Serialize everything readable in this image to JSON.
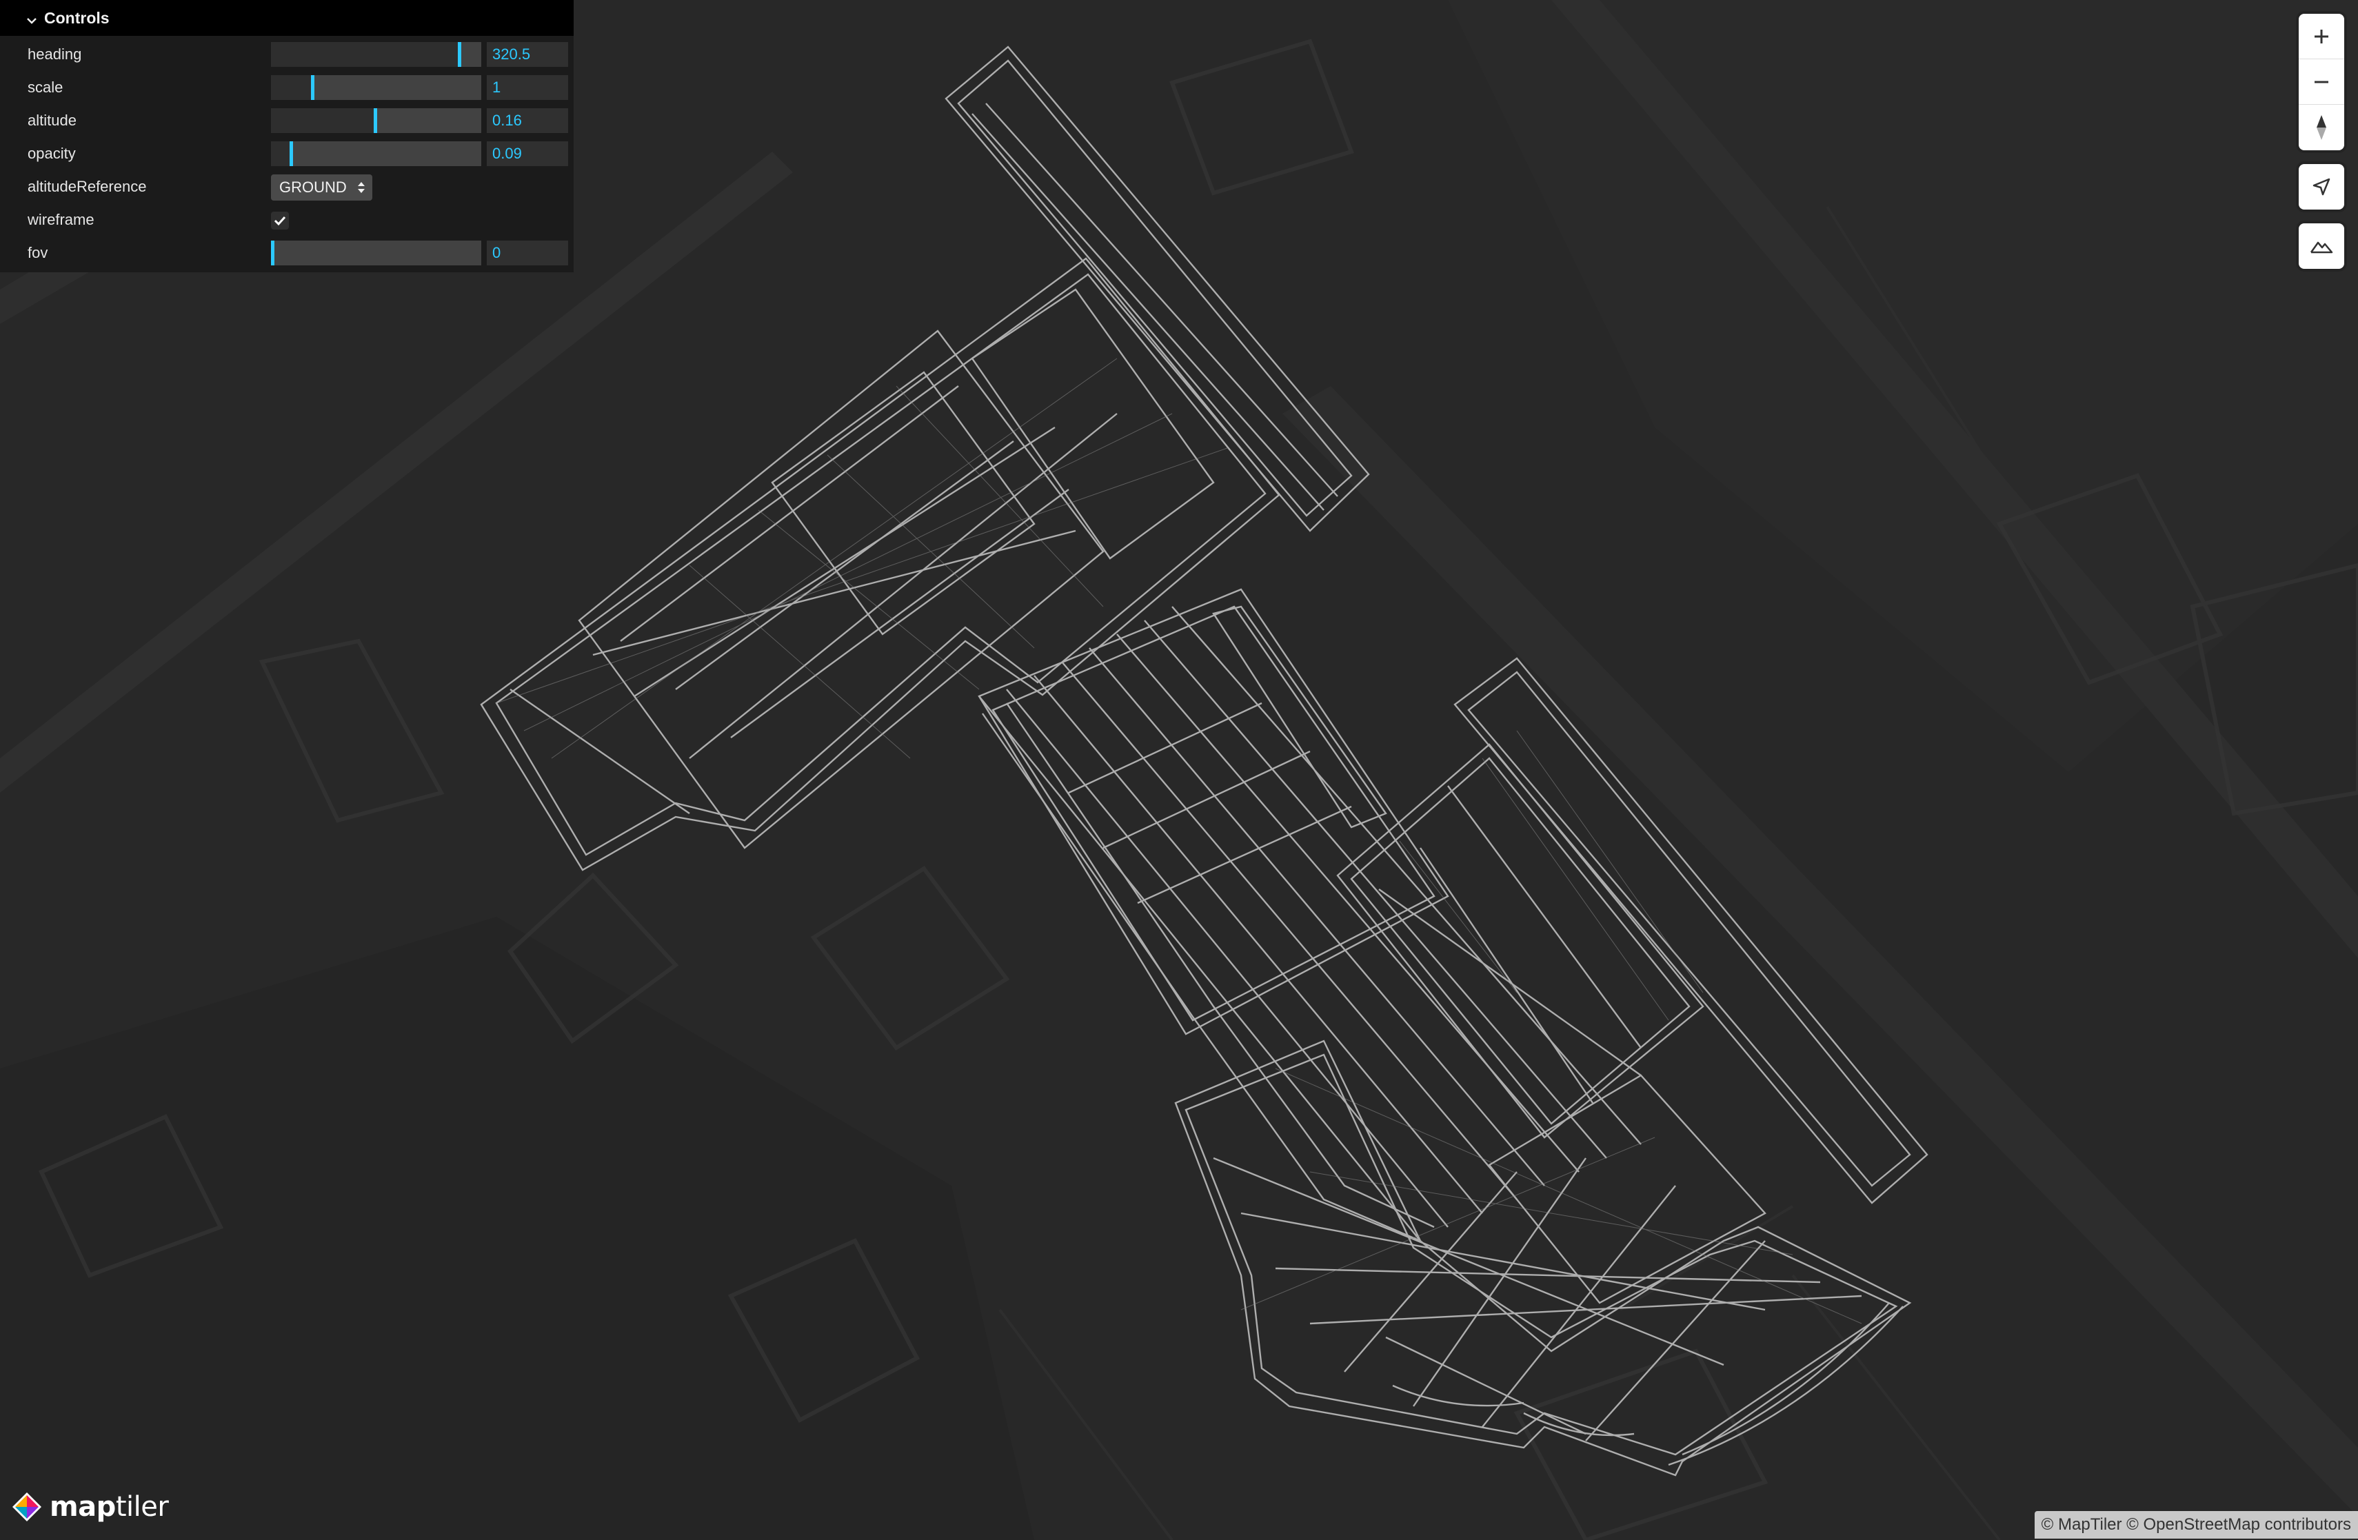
{
  "controls": {
    "title": "Controls",
    "rows": {
      "heading": {
        "label": "heading",
        "value": "320.5",
        "fraction": 0.89
      },
      "scale": {
        "label": "scale",
        "value": "1",
        "fraction": 0.19
      },
      "altitude": {
        "label": "altitude",
        "value": "0.16",
        "fraction": 0.49
      },
      "opacity": {
        "label": "opacity",
        "value": "0.09",
        "fraction": 0.09
      },
      "altitudeReference": {
        "label": "altitudeReference",
        "value": "GROUND"
      },
      "wireframe": {
        "label": "wireframe",
        "checked": true
      },
      "fov": {
        "label": "fov",
        "value": "0",
        "fraction": 0.0
      }
    }
  },
  "map": {
    "nav": {
      "zoom_in": "zoom-in-icon",
      "zoom_out": "zoom-out-icon",
      "compass": "compass-icon",
      "geolocate": "geolocate-icon",
      "terrain": "terrain-icon"
    },
    "logo": {
      "brand": "map",
      "brand_light": "tiler"
    },
    "attribution": "© MapTiler © OpenStreetMap contributors"
  },
  "colors": {
    "accent": "#2cc9ff",
    "background": "#282828",
    "panel": "#1b1b1b"
  }
}
